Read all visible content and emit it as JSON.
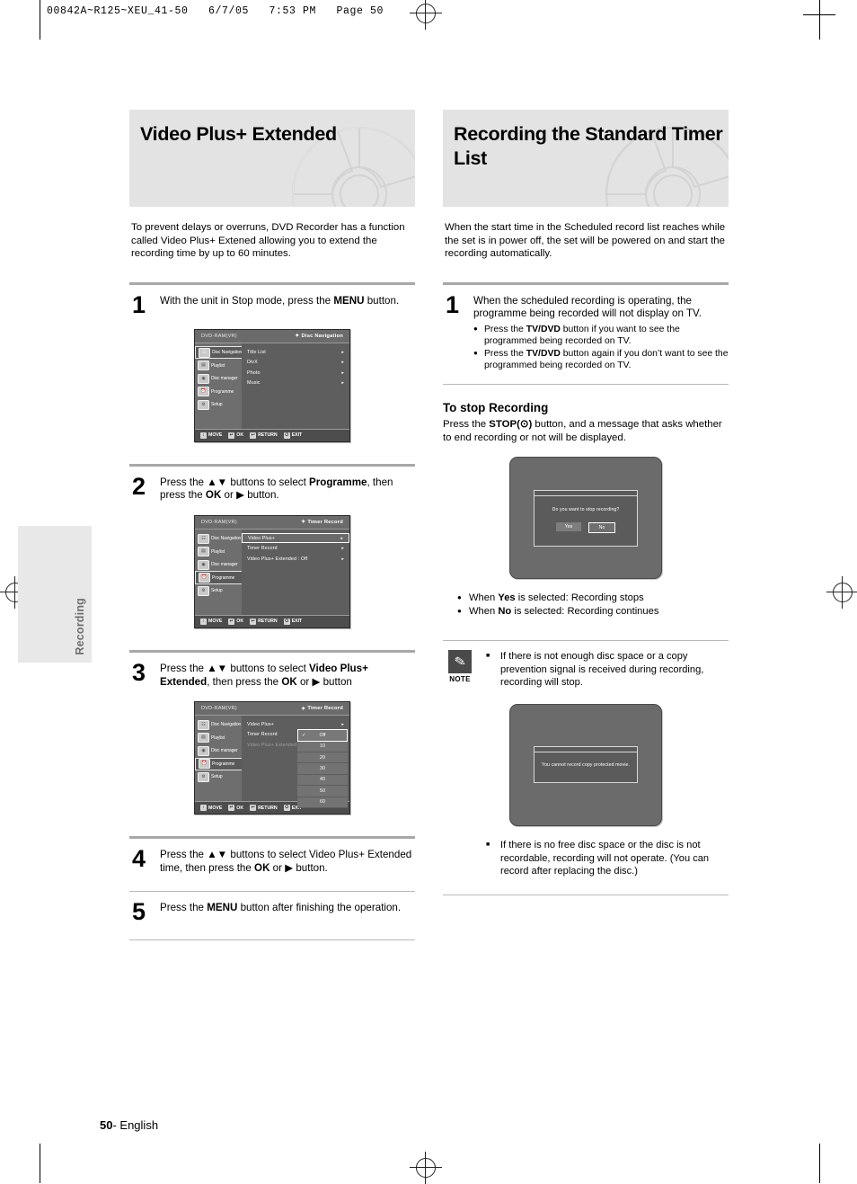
{
  "prepress": {
    "header": "00842A~R125~XEU_41-50   6/7/05   7:53 PM   Page 50"
  },
  "side_tab": {
    "label": "Recording"
  },
  "footer": {
    "page": "50",
    "suffix": "- English"
  },
  "left_column": {
    "banner_title": "Video Plus+ Extended",
    "intro": "To prevent delays or overruns, DVD Recorder has a function called Video Plus+ Extened allowing you to extend the recording time by up to 60 minutes.",
    "steps": [
      {
        "num": "1",
        "text_1": "With the unit in Stop mode, press the ",
        "bold_1": "MENU",
        "text_2": " button."
      },
      {
        "num": "2",
        "text_1": "Press the ▲▼ buttons to select ",
        "bold_1": "Programme",
        "text_2": ", then press the ",
        "bold_2": "OK",
        "text_3": " or ▶ button."
      },
      {
        "num": "3",
        "text_1": "Press the ▲▼ buttons to select ",
        "bold_1": "Video Plus+ Extended",
        "text_2": ", then press the ",
        "bold_2": "OK",
        "text_3": " or ▶ button"
      },
      {
        "num": "4",
        "text_1": "Press the ▲▼ buttons to select Video Plus+ Extended time, then press the ",
        "bold_1": "OK",
        "text_2": " or ▶ button."
      },
      {
        "num": "5",
        "text_1": "Press the ",
        "bold_1": "MENU",
        "text_2": " button after finishing the operation."
      }
    ]
  },
  "right_column": {
    "banner_title": "Recording the Standard Timer List",
    "intro": "When the start time in the Scheduled record list reaches while the set is in power off, the set will be powered on and start the recording automatically.",
    "step1": {
      "num": "1",
      "text": "When the scheduled recording is operating, the programme being recorded will not display on TV.",
      "bullets": [
        {
          "pre": "Press the ",
          "bold": "TV/DVD",
          "post": " button if you want to see the programmed being recorded on TV."
        },
        {
          "pre": "Press the ",
          "bold": "TV/DVD",
          "post": " button again if you don’t want to see the programmed being recorded on TV."
        }
      ]
    },
    "stop_section": {
      "heading": "To stop Recording",
      "text_1": "Press the ",
      "bold_1": "STOP(",
      "stop_glyph": "⊙",
      "bold_2": ")",
      "text_2": " button, and a message that asks whether to end recording or not will be displayed."
    },
    "result_bullets": [
      {
        "pre": "When ",
        "bold": "Yes",
        "post": " is selected: Recording stops"
      },
      {
        "pre": "When ",
        "bold": "No",
        "post": " is selected: Recording continues"
      }
    ],
    "note": {
      "caption": "NOTE",
      "icon": "pencil-icon",
      "item_1": "If there is not enough disc space or a copy prevention signal is received during recording, recording will stop.",
      "item_2": "If there is no free disc space or the disc is not recordable, recording will not operate. (You can record after replacing the disc.)"
    }
  },
  "osd_common": {
    "disc_label": "DVD-RAM(VR)",
    "footer": [
      {
        "key": "↕",
        "label": "MOVE"
      },
      {
        "key": "↵",
        "label": "OK"
      },
      {
        "key": "↩",
        "label": "RETURN"
      },
      {
        "key": "⏻",
        "label": "EXIT"
      }
    ],
    "sidebar": [
      {
        "label": "Disc Navigation",
        "icon": "disc-navigation-icon"
      },
      {
        "label": "Playlist",
        "icon": "playlist-icon"
      },
      {
        "label": "Disc manager",
        "icon": "disc-manager-icon"
      },
      {
        "label": "Programme",
        "icon": "programme-icon"
      },
      {
        "label": "Setup",
        "icon": "setup-icon"
      }
    ]
  },
  "osd_screens": [
    {
      "name": "disc-navigation-menu",
      "mode_title": "Disc Navigation",
      "active_index": 0,
      "rows": [
        {
          "label": "Title List",
          "arrow": "▸",
          "selected": false,
          "dim": false
        },
        {
          "label": "DivX",
          "arrow": "▸",
          "selected": false,
          "dim": false
        },
        {
          "label": "Photo",
          "arrow": "▸",
          "selected": false,
          "dim": false
        },
        {
          "label": "Music",
          "arrow": "▸",
          "selected": false,
          "dim": false
        }
      ]
    },
    {
      "name": "timer-record-menu",
      "mode_title": "Timer Record",
      "active_index": 3,
      "rows": [
        {
          "label": "Video Plus+",
          "arrow": "▸",
          "selected": true,
          "dim": false
        },
        {
          "label": "Timer Record",
          "arrow": "▸",
          "selected": false,
          "dim": false
        },
        {
          "label": "Video Plus+ Extended : Off",
          "arrow": "▸",
          "selected": false,
          "dim": false
        }
      ]
    },
    {
      "name": "timer-record-extended-dropdown",
      "mode_title": "Timer Record",
      "active_index": 3,
      "rows": [
        {
          "label": "Video Plus+",
          "arrow": "▸",
          "selected": false,
          "dim": false
        },
        {
          "label": "Timer Record",
          "arrow": "",
          "selected": false,
          "dim": false
        },
        {
          "label": "Video Plus+ Extended",
          "arrow": "",
          "selected": false,
          "dim": true
        }
      ],
      "dropdown": [
        {
          "label": "Off",
          "checked": true,
          "selected": true
        },
        {
          "label": "10",
          "checked": false,
          "selected": false
        },
        {
          "label": "20",
          "checked": false,
          "selected": false
        },
        {
          "label": "30",
          "checked": false,
          "selected": false
        },
        {
          "label": "40",
          "checked": false,
          "selected": false
        },
        {
          "label": "50",
          "checked": false,
          "selected": false
        },
        {
          "label": "60",
          "checked": false,
          "selected": false
        }
      ]
    }
  ],
  "tv_dialogs": [
    {
      "name": "stop-recording-dialog",
      "message": "Do you want to stop recording?",
      "buttons": [
        {
          "label": "Yes",
          "focused": false
        },
        {
          "label": "No",
          "focused": true
        }
      ]
    },
    {
      "name": "copy-protected-dialog",
      "message": "You cannot record copy protected movie.",
      "buttons": []
    }
  ]
}
